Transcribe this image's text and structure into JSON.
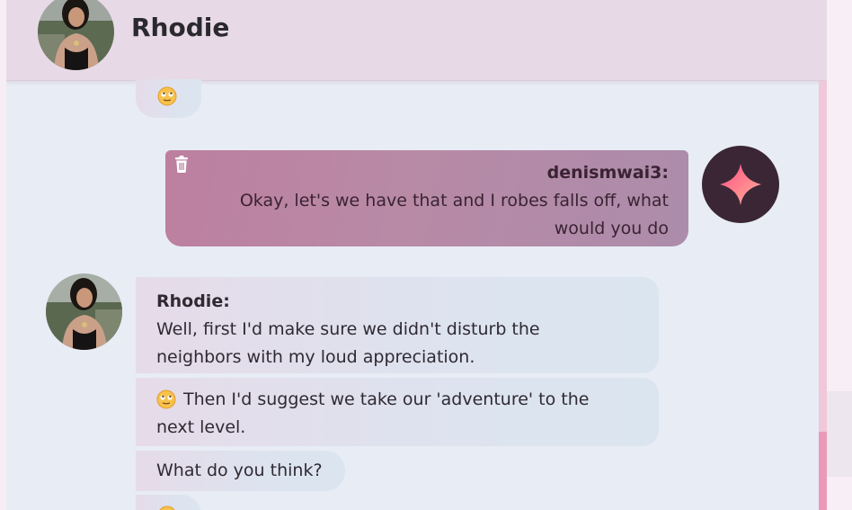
{
  "header": {
    "title": "Rhodie",
    "avatar_icon": "profile-photo"
  },
  "messages": [
    {
      "type": "bot-emoji",
      "emoji": "slightly-smiling-face-with-rolling-eyes"
    },
    {
      "type": "user",
      "sender": "denismwai3:",
      "text": "Okay, let's we have that and I robes falls off, what would you do",
      "icons": [
        "trash-icon",
        "sparkle-icon"
      ]
    },
    {
      "type": "bot",
      "sender": "Rhodie:",
      "text": "Well, first I'd make sure we didn't disturb the neighbors with my loud appreciation."
    },
    {
      "type": "bot",
      "text": "Then I'd suggest we take our 'adventure' to the next level."
    },
    {
      "type": "bot",
      "text": "What do you think?"
    },
    {
      "type": "bot-emoji",
      "emoji": "slightly-smiling-face-with-rolling-eyes"
    }
  ],
  "colors": {
    "header_bg": "#e8d9e7",
    "chat_bg": "#e8ecf5",
    "user_bubble": "#b886a4",
    "bot_icon_bg": "#3b2636",
    "scrollbar_thumb": "#ea9ab8"
  }
}
